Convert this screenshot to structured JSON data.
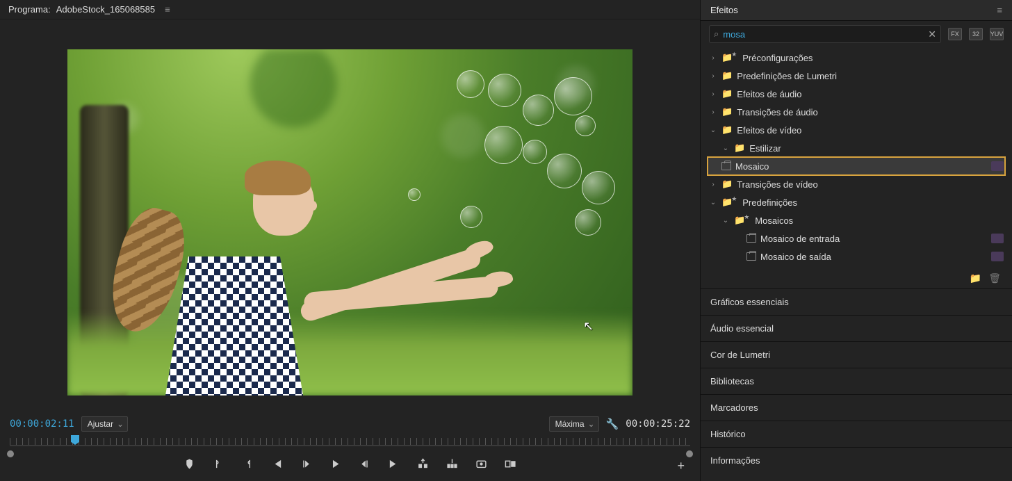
{
  "program": {
    "title_prefix": "Programa:",
    "title_name": "AdobeStock_165068585",
    "timecode_in": "00:00:02:11",
    "timecode_out": "00:00:25:22",
    "zoom_label": "Ajustar",
    "quality_label": "Máxima"
  },
  "effects": {
    "panel_title": "Efeitos",
    "search_value": "mosa",
    "filter_badges": [
      "FX",
      "32",
      "YUV"
    ],
    "tree": {
      "preconfigs": "Préconfigurações",
      "lumetri_presets": "Predefinições de Lumetri",
      "audio_effects": "Efeitos de áudio",
      "audio_transitions": "Transições de áudio",
      "video_effects": "Efeitos de vídeo",
      "stylize": "Estilizar",
      "mosaic": "Mosaico",
      "video_transitions": "Transições de vídeo",
      "presets": "Predefinições",
      "mosaics_folder": "Mosaicos",
      "mosaic_in": "Mosaico de entrada",
      "mosaic_out": "Mosaico de saída"
    }
  },
  "panels": {
    "essential_graphics": "Gráficos essenciais",
    "essential_audio": "Áudio essencial",
    "lumetri_color": "Cor de Lumetri",
    "libraries": "Bibliotecas",
    "markers": "Marcadores",
    "history": "Histórico",
    "info": "Informações"
  }
}
